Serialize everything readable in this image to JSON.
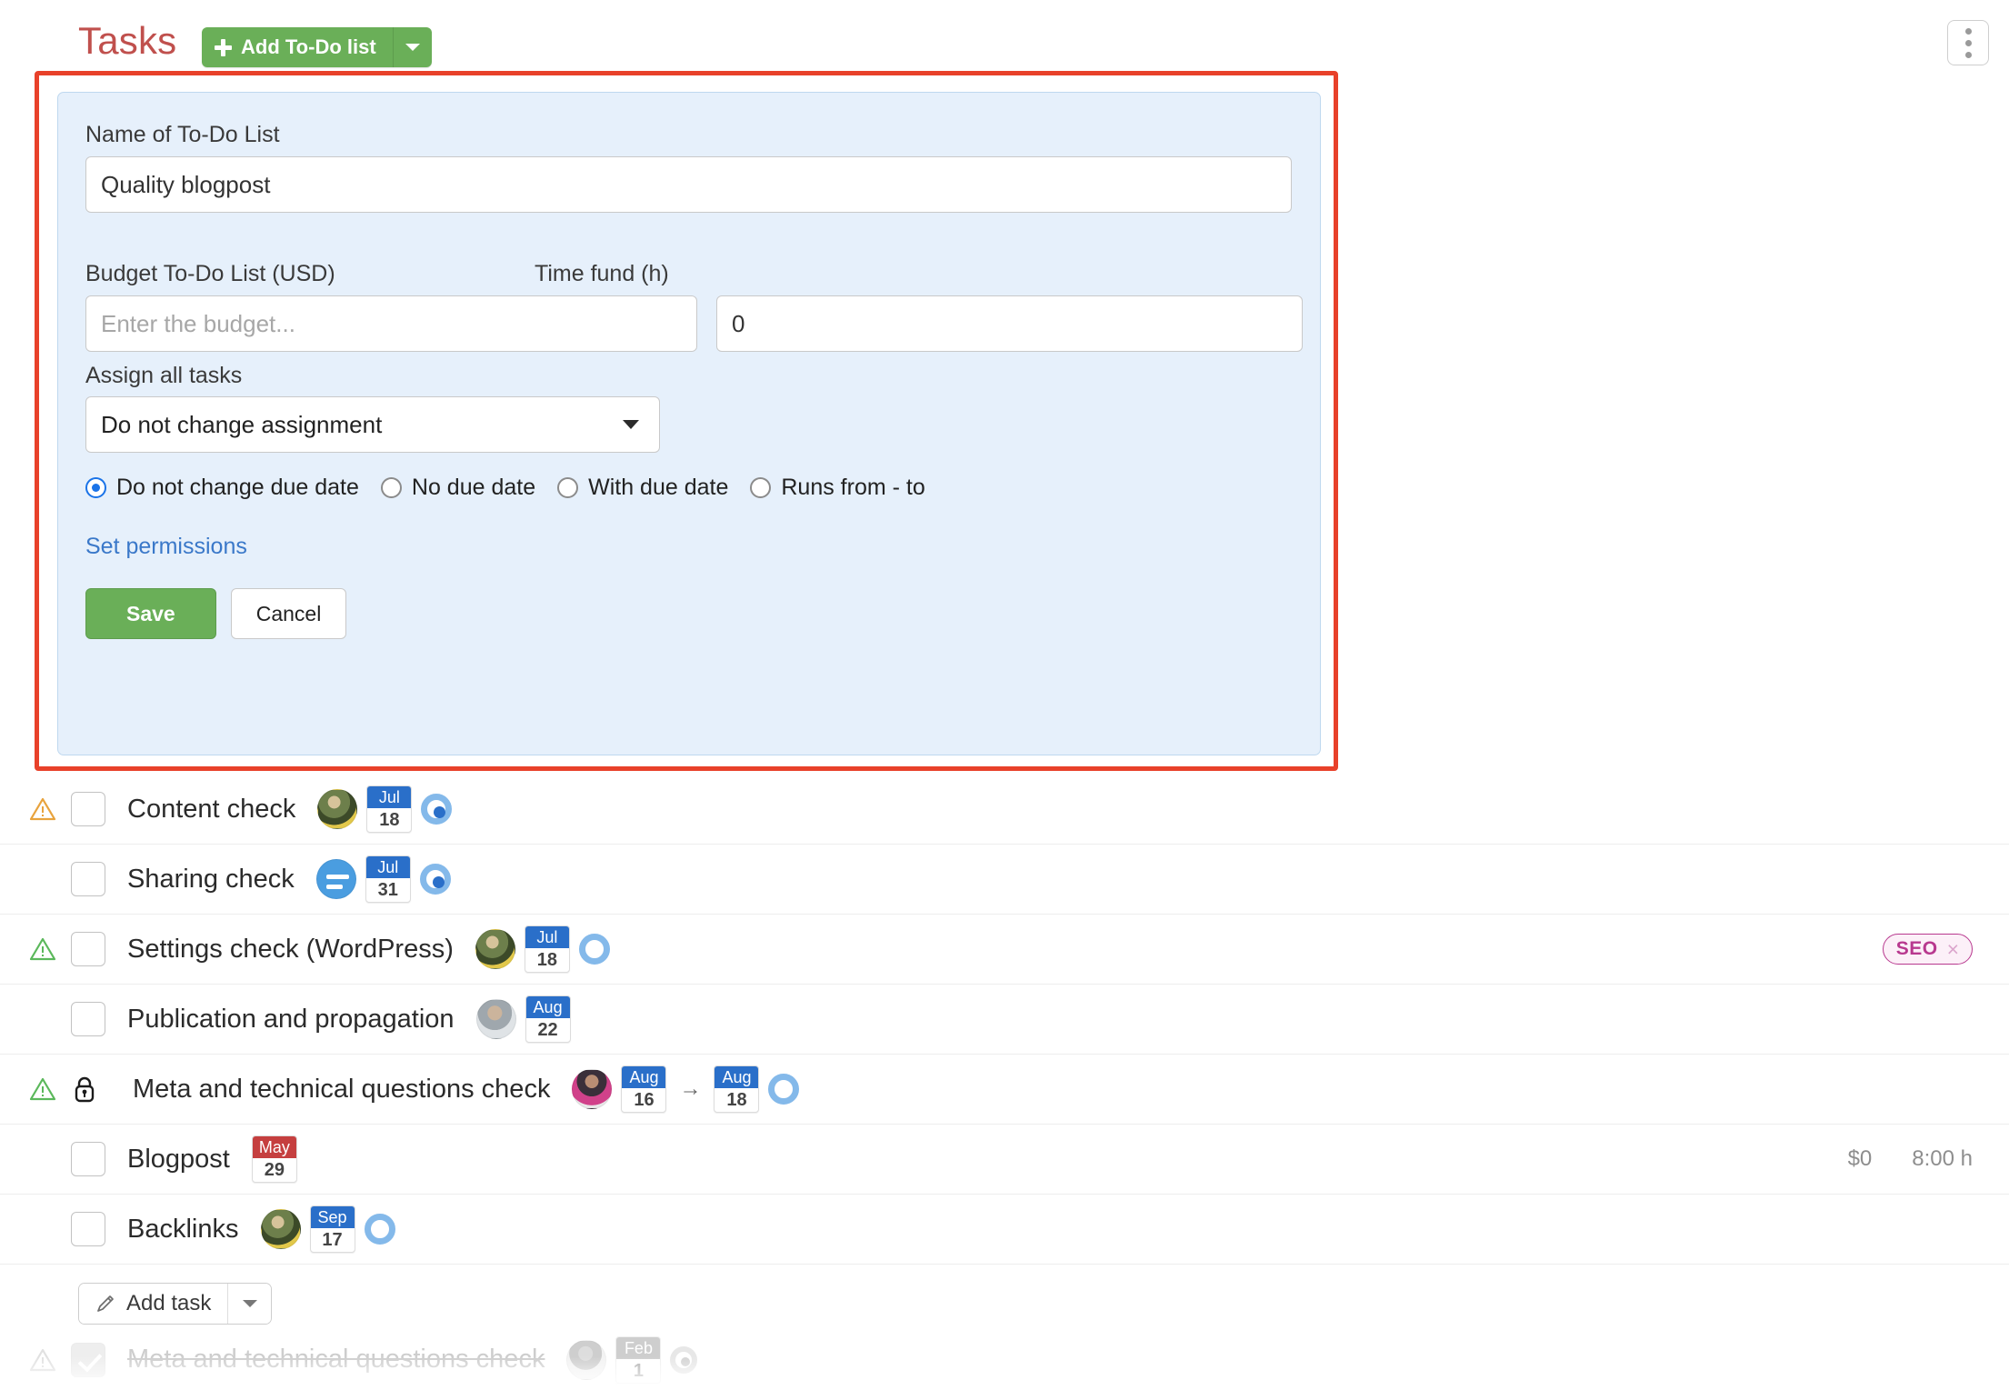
{
  "header": {
    "title": "Tasks",
    "add_todo_label": "Add To-Do list",
    "kebab_name": "more-options"
  },
  "form": {
    "name_label": "Name of To-Do List",
    "name_value": "Quality blogpost",
    "budget_label": "Budget To-Do List (USD)",
    "budget_placeholder": "Enter the budget...",
    "budget_value": "",
    "time_label": "Time fund (h)",
    "time_value": "0",
    "assign_label": "Assign all tasks",
    "assign_selected": "Do not change assignment",
    "due_options": [
      {
        "label": "Do not change due date",
        "checked": true
      },
      {
        "label": "No due date",
        "checked": false
      },
      {
        "label": "With due date",
        "checked": false
      },
      {
        "label": "Runs from - to",
        "checked": false
      }
    ],
    "permissions_link": "Set permissions",
    "save_label": "Save",
    "cancel_label": "Cancel",
    "highlight_color": "#e8412a",
    "panel_bg": "#e6f0fb",
    "accent_green": "#6aaf58",
    "link_blue": "#3a78c9"
  },
  "tasks": [
    {
      "name": "Content check",
      "warning": "amber",
      "locked": false,
      "checked": false,
      "avatar": "photo1",
      "dates": [
        {
          "month": "Jul",
          "day": "18",
          "color": "blue"
        }
      ],
      "status": "filled",
      "tag": null,
      "cost": null,
      "time": null
    },
    {
      "name": "Sharing check",
      "warning": null,
      "locked": false,
      "checked": false,
      "avatar": "group",
      "dates": [
        {
          "month": "Jul",
          "day": "31",
          "color": "blue"
        }
      ],
      "status": "filled",
      "tag": null,
      "cost": null,
      "time": null
    },
    {
      "name": "Settings check (WordPress)",
      "warning": "green",
      "locked": false,
      "checked": false,
      "avatar": "photo1",
      "dates": [
        {
          "month": "Jul",
          "day": "18",
          "color": "blue"
        }
      ],
      "status": "ring",
      "tag": {
        "label": "SEO",
        "close": "×"
      },
      "cost": null,
      "time": null
    },
    {
      "name": "Publication and propagation",
      "warning": null,
      "locked": false,
      "checked": false,
      "avatar": "photo2",
      "dates": [
        {
          "month": "Aug",
          "day": "22",
          "color": "blue"
        }
      ],
      "status": null,
      "tag": null,
      "cost": null,
      "time": null
    },
    {
      "name": "Meta and technical questions check",
      "warning": "green",
      "locked": true,
      "checked": false,
      "avatar": "photo3",
      "dates": [
        {
          "month": "Aug",
          "day": "16",
          "color": "blue"
        },
        {
          "month": "Aug",
          "day": "18",
          "color": "blue"
        }
      ],
      "date_separator": "→",
      "status": "ring",
      "tag": null,
      "cost": null,
      "time": null
    },
    {
      "name": "Blogpost",
      "warning": null,
      "locked": false,
      "checked": false,
      "avatar": null,
      "dates": [
        {
          "month": "May",
          "day": "29",
          "color": "red"
        }
      ],
      "status": null,
      "tag": null,
      "cost": "$0",
      "time": "8:00 h"
    },
    {
      "name": "Backlinks",
      "warning": null,
      "locked": false,
      "checked": false,
      "avatar": "photo1",
      "dates": [
        {
          "month": "Sep",
          "day": "17",
          "color": "blue"
        }
      ],
      "status": "ring",
      "tag": null,
      "cost": null,
      "time": null
    }
  ],
  "add_task": {
    "label": "Add task"
  },
  "completed_task": {
    "name": "Meta and technical questions check",
    "warning": "grey",
    "checked": true,
    "avatar": "photo4",
    "dates": [
      {
        "month": "Feb",
        "day": "1",
        "color": "grey"
      }
    ],
    "status": "filled-grey"
  }
}
